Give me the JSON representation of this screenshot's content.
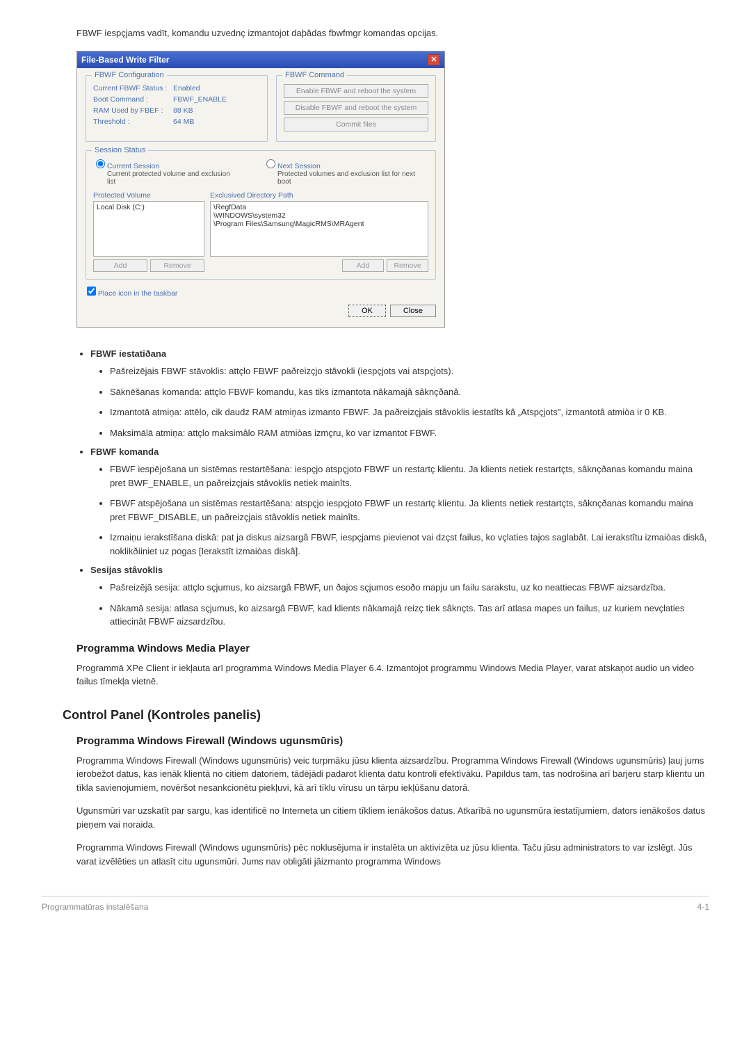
{
  "intro": "FBWF iespçjams vadīt, komandu uzvednç izmantojot daþâdas fbwfmgr komandas opcijas.",
  "dialog": {
    "title": "File-Based Write Filter",
    "close": "✕",
    "config": {
      "legend": "FBWF Configuration",
      "rows": [
        {
          "label": "Current FBWF Status :",
          "value": "Enabled"
        },
        {
          "label": "Boot Command :",
          "value": "FBWF_ENABLE"
        },
        {
          "label": "RAM Used by FBEF :",
          "value": "88 KB"
        },
        {
          "label": "Threshold :",
          "value": "64 MB"
        }
      ]
    },
    "command": {
      "legend": "FBWF Command",
      "btn1": "Enable FBWF and reboot the system",
      "btn2": "Disable FBWF and reboot the system",
      "btn3": "Commit files"
    },
    "session": {
      "legend": "Session Status",
      "current_label": "Current Session",
      "current_sub": "Current  protected volume and exclusion list",
      "next_label": "Next Session",
      "next_sub": "Protected volumes and exclusion list for next boot",
      "protected_label": "Protected Volume",
      "protected_item": "Local Disk (C:)",
      "exclusived_label": "Exclusived Directory Path",
      "ex_items": [
        "\\RegfData",
        "\\WINDOWS\\system32",
        "\\Program Files\\Samsung\\MagicRMS\\MRAgent"
      ],
      "add": "Add",
      "remove": "Remove"
    },
    "checkbox": "Place icon in the taskbar",
    "ok": "OK",
    "close_btn": "Close"
  },
  "bullets": {
    "item1_head": "FBWF iestatīðana",
    "item1_subs": [
      "Pašreizējais FBWF stāvoklis: attçlo FBWF paðreizçjo stâvokli (iespçjots vai atspçjots).",
      "Sāknēšanas komanda: attçlo FBWF komandu, kas tiks izmantota nâkamajâ sâknçðanâ.",
      "Izmantotā atmiņa: attēlo, cik daudz RAM atmiņas izmanto FBWF. Ja paðreizçjais stâvoklis iestatîts kâ „Atspçjots\", izmantotâ atmiòa ir 0 KB.",
      "Maksimālā atmiņa: attçlo maksimâlo RAM atmiòas izmçru, ko var izmantot FBWF."
    ],
    "item2_head": "FBWF komanda",
    "item2_subs": [
      "FBWF iespējošana un sistēmas restartēšana: iespçjo atspçjoto FBWF un restartç klientu. Ja klients netiek restartçts, sâknçðanas komandu maina pret BWF_ENABLE, un paðreizçjais stâvoklis netiek mainîts.",
      "FBWF atspējošana un sistēmas restartēšana: atspçjo iespçjoto FBWF un restartç klientu. Ja klients netiek restartçts, sâknçðanas komandu maina pret FBWF_DISABLE, un paðreizçjais stâvoklis netiek mainîts.",
      "Izmaiņu ierakstīšana diskā: pat ja diskus aizsargâ FBWF, iespçjams pievienot vai dzçst failus, ko vçlaties tajos saglabât. Lai ierakstîtu izmaiòas diskâ, noklikðíiniet uz pogas [Ierakstît izmaiòas diskâ]."
    ],
    "item3_head": "Sesijas stâvoklis",
    "item3_subs": [
      "Pašreizējā sesija: attçlo sçjumus, ko aizsargâ FBWF, un ðajos sçjumos esoðo mapju un failu sarakstu, uz ko neattiecas FBWF aizsardzîba.",
      "Nākamā sesija: atlasa sçjumus, ko aizsargâ FBWF, kad klients nâkamajâ reizç tiek sâknçts. Tas arî atlasa mapes un failus, uz kuriem nevçlaties attiecinât FBWF aizsardzîbu."
    ]
  },
  "wmp": {
    "heading": "Programma Windows Media Player",
    "text": "Programmā XPe Client ir iekļauta arī programma Windows Media Player 6.4. Izmantojot programmu Windows Media Player, varat atskaņot audio un video failus tīmekļa vietnē."
  },
  "cp": {
    "heading": "Control Panel (Kontroles panelis)",
    "fw_heading": "Programma Windows Firewall (Windows ugunsmūris)",
    "p1": "Programma Windows Firewall (Windows ugunsmūris) veic turpmāku jūsu klienta aizsardzību. Programma Windows Firewall (Windows ugunsmūris) ļauj jums ierobežot datus, kas ienāk klientā no citiem datoriem, tādējādi padarot klienta datu kontroli efektīvāku. Papildus tam, tas nodrošina arī barjeru starp klientu un tīkla savienojumiem, novēršot nesankcionētu piekļuvi, kā arī tīklu vīrusu un tārpu iekļūšanu datorā.",
    "p2": "Ugunsmūri var uzskatīt par sargu, kas identificē no Interneta un citiem tīkliem ienākošos datus. Atkarībā no ugunsmūra iestatījumiem, dators ienākošos datus pieņem vai noraida.",
    "p3": "Programma Windows Firewall (Windows ugunsmūris) pēc noklusējuma ir instalēta un aktivizēta uz jūsu klienta. Taču jūsu administrators to var izslēgt. Jūs varat izvēlēties un atlasīt citu ugunsmūri. Jums nav obligāti jāizmanto programma Windows"
  },
  "footer": {
    "left": "Programmatūras instalēšana",
    "right": "4-1"
  }
}
